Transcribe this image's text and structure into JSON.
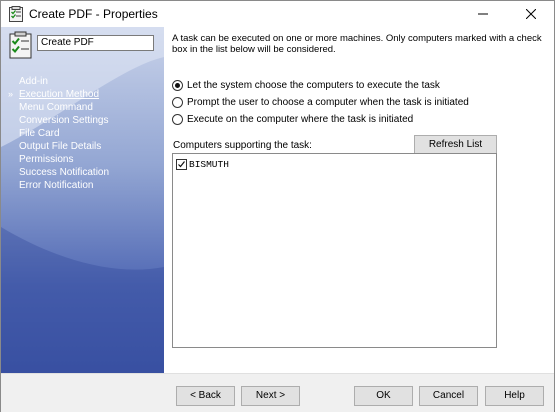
{
  "window": {
    "title": "Create PDF - Properties",
    "icon": "task-icon"
  },
  "sidebar": {
    "task_name": "Create PDF",
    "items": [
      {
        "label": "Add-in",
        "active": false
      },
      {
        "label": "Execution Method",
        "active": true
      },
      {
        "label": "Menu Command",
        "active": false
      },
      {
        "label": "Conversion Settings",
        "active": false
      },
      {
        "label": "File Card",
        "active": false
      },
      {
        "label": "Output File Details",
        "active": false
      },
      {
        "label": "Permissions",
        "active": false
      },
      {
        "label": "Success Notification",
        "active": false
      },
      {
        "label": "Error Notification",
        "active": false
      }
    ],
    "active_bullet": "»"
  },
  "main": {
    "description": "A task can be executed on one or more machines. Only computers marked with a check box in the list below will be considered.",
    "options": [
      {
        "label": "Let the system choose the computers to execute the task",
        "checked": true
      },
      {
        "label": "Prompt the user to choose a computer when the task is initiated",
        "checked": false
      },
      {
        "label": "Execute on the computer where the task is initiated",
        "checked": false
      }
    ],
    "computers_label": "Computers supporting the task:",
    "refresh_label": "Refresh List",
    "computers": [
      {
        "name": "BISMUTH",
        "checked": true
      }
    ]
  },
  "footer": {
    "back_label": "< Back",
    "next_label": "Next >",
    "ok_label": "OK",
    "cancel_label": "Cancel",
    "help_label": "Help"
  },
  "colors": {
    "sidebar_top": "#c9d3ea",
    "sidebar_bottom": "#3e56a7",
    "footer_bg": "#f0f0f0",
    "button_bg": "#e1e1e1"
  }
}
